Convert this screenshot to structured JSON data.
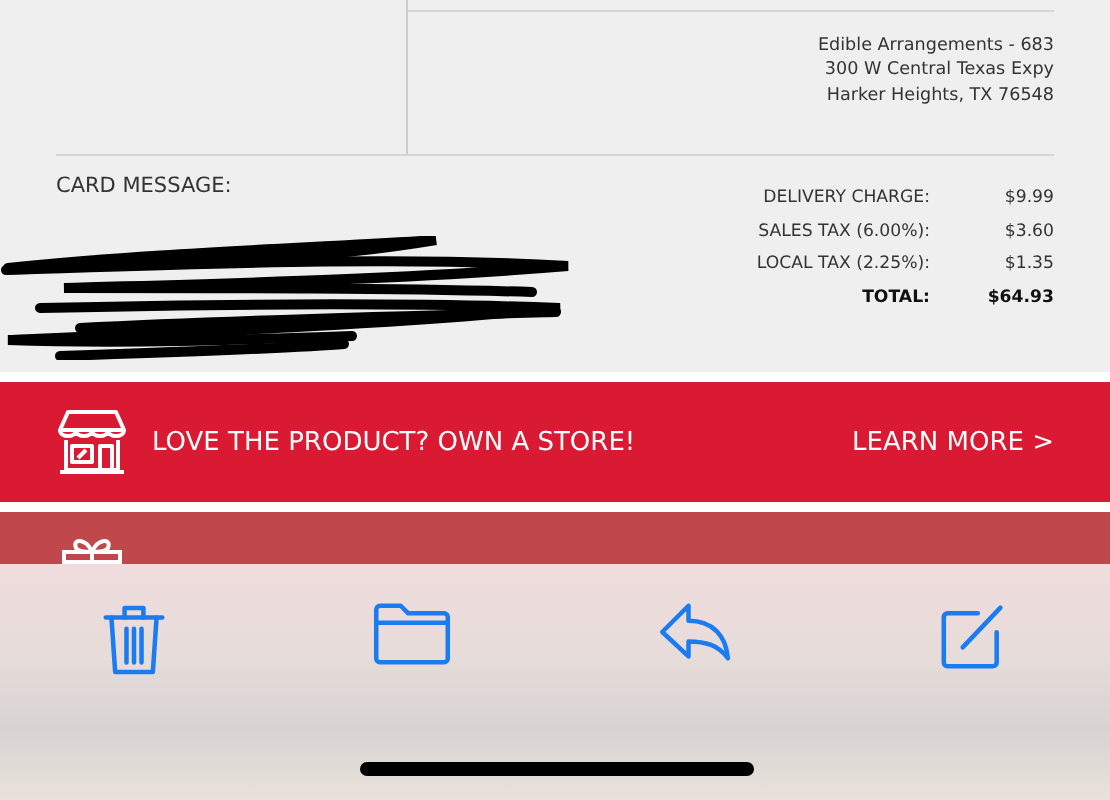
{
  "store_address": [
    "Edible Arrangements - 683",
    "300 W Central Texas Expy",
    "Harker Heights, TX 76548"
  ],
  "card_message": {
    "label": "CARD MESSAGE:"
  },
  "charges": [
    {
      "label": "DELIVERY CHARGE:",
      "amount": "$9.99",
      "kind": "line"
    },
    {
      "label": "SALES TAX (6.00%):",
      "amount": "$3.60",
      "kind": "line"
    },
    {
      "label": "LOCAL TAX (2.25%):",
      "amount": "$1.35",
      "kind": "line"
    },
    {
      "label": "TOTAL:",
      "amount": "$64.93",
      "kind": "total"
    }
  ],
  "banners": [
    {
      "text": "LOVE THE PRODUCT? OWN A STORE!",
      "link": "LEARN MORE >"
    }
  ]
}
